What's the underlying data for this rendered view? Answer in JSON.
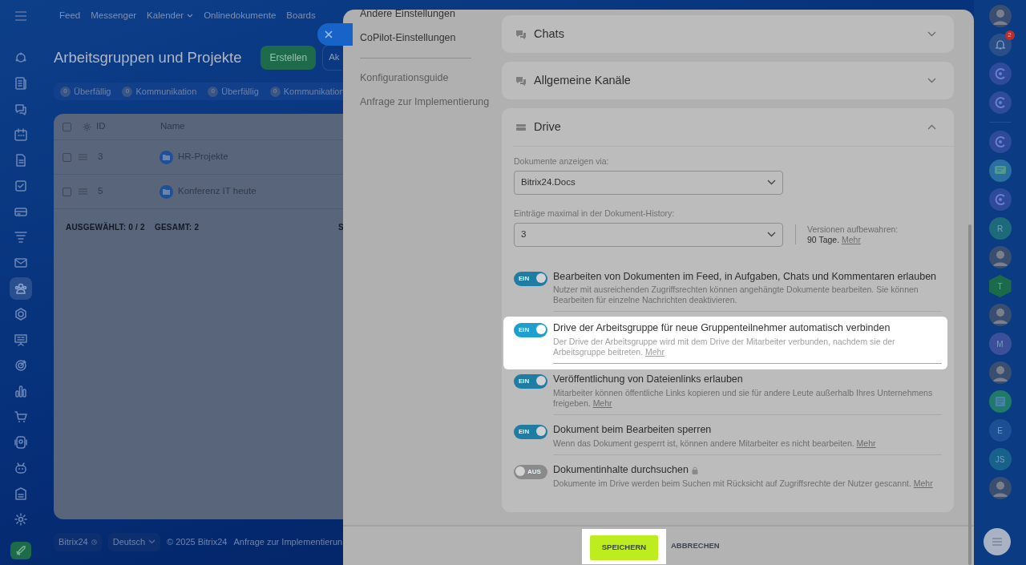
{
  "left_rail": [
    {
      "selected": false
    },
    {
      "selected": false
    },
    {
      "selected": false
    },
    {
      "selected": false
    },
    {
      "selected": false
    },
    {
      "selected": false
    },
    {
      "selected": false
    },
    {
      "selected": false
    },
    {
      "selected": false
    },
    {
      "selected": true
    },
    {
      "selected": false
    },
    {
      "selected": false
    },
    {
      "selected": false
    },
    {
      "selected": false
    },
    {
      "selected": false
    },
    {
      "selected": false
    },
    {
      "selected": false
    },
    {
      "selected": false
    },
    {
      "selected": false
    }
  ],
  "top_nav": [
    {
      "label": "Feed",
      "kind": "link"
    },
    {
      "label": "Messenger",
      "kind": "link"
    },
    {
      "label": "Kalender",
      "kind": "dropdown"
    },
    {
      "label": "Onlinedokumente",
      "kind": "link"
    },
    {
      "label": "Boards",
      "kind": "link"
    }
  ],
  "page": {
    "title": "Arbeitsgruppen und Projekte",
    "buttons": [
      {
        "label": "Erstellen",
        "kind": "primary"
      },
      {
        "label": "Ak",
        "kind": "secondary"
      }
    ],
    "counters": [
      {
        "count": "0",
        "label": "Überfällig"
      },
      {
        "count": "0",
        "label": "Kommunikation"
      },
      {
        "count": "0",
        "label": "Überfällig"
      },
      {
        "count": "0",
        "label": "Kommunikation"
      }
    ],
    "grid": {
      "columns": [
        "ID",
        "Name"
      ],
      "select_all_checked": false,
      "rows": [
        {
          "id": "3",
          "name": "HR-Projekte",
          "selected": false
        },
        {
          "id": "5",
          "name": "Konferenz IT heute",
          "selected": false
        }
      ],
      "footer": [
        {
          "label": "AUSGEWÄHLT:",
          "value": "0 / 2"
        },
        {
          "label": "GESAMT:",
          "value": "2"
        },
        {
          "label": "S"
        }
      ]
    }
  },
  "footer": {
    "brand": "Bitrix24",
    "language": "Deutsch",
    "copyright": "© 2025 Bitrix24",
    "link": "Anfrage zur Implementierun"
  },
  "right_rail": [
    {
      "kind": "avatar"
    },
    {
      "kind": "bell",
      "badge": "2"
    },
    {
      "kind": "app"
    },
    {
      "kind": "app"
    },
    {
      "kind": "divider"
    },
    {
      "kind": "app"
    },
    {
      "kind": "chat"
    },
    {
      "kind": "app"
    },
    {
      "kind": "letter",
      "text": "R",
      "color": "#1d6b7a"
    },
    {
      "kind": "avatar"
    },
    {
      "kind": "hexagon",
      "text": "T",
      "color": "#1b6b4a"
    },
    {
      "kind": "avatar"
    },
    {
      "kind": "letter",
      "text": "M",
      "color": "#3b4f9a"
    },
    {
      "kind": "avatar"
    },
    {
      "kind": "news"
    },
    {
      "kind": "letter",
      "text": "E",
      "color": "#1c4f93"
    },
    {
      "kind": "letter",
      "text": "JS",
      "color": "#17628a"
    },
    {
      "kind": "avatar"
    }
  ],
  "panel": {
    "menu": [
      {
        "label": "Andere Einstellungen",
        "kind": "item"
      },
      {
        "label": "CoPilot-Einstellungen",
        "kind": "item"
      },
      {
        "kind": "divider"
      },
      {
        "label": "Konfigurationsguide",
        "kind": "muted"
      },
      {
        "label": "Anfrage zur Implementierung",
        "kind": "muted"
      }
    ],
    "sections": [
      {
        "title": "Chats",
        "expanded": false
      },
      {
        "title": "Allgemeine Kanäle",
        "expanded": false
      },
      {
        "title": "Drive",
        "expanded": true,
        "selects": [
          {
            "label": "Dokumente anzeigen via:",
            "value": "Bitrix24.Docs"
          },
          {
            "label": "Einträge maximal in der Dokument-History:",
            "value": "3",
            "note": "Versionen aufbewahren:",
            "note_value": "90 Tage.",
            "note_link": "Mehr"
          }
        ],
        "toggles": [
          {
            "title": "Bearbeiten von Dokumenten im Feed, in Aufgaben, Chats und Kommentaren erlauben",
            "description": "Nutzer mit ausreichenden Zugriffsrechten können angehängte Dokumente bearbeiten. Sie können Bearbeiten für einzelne Nachrichten deaktivieren.",
            "on": true,
            "switch_label": "EIN",
            "highlighted": false,
            "locked": false
          },
          {
            "title": "Drive der Arbeitsgruppe für neue Gruppenteilnehmer automatisch verbinden",
            "description": "Der Drive der Arbeitsgruppe wird mit dem Drive der Mitarbeiter verbunden, nachdem sie der Arbeitsgruppe beitreten.",
            "link": "Mehr",
            "on": true,
            "switch_label": "EIN",
            "highlighted": true,
            "locked": false
          },
          {
            "title": "Veröffentlichung von Dateienlinks erlauben",
            "description": "Mitarbeiter können öffentliche Links kopieren und sie für andere Leute außerhalb Ihres Unternehmens freigeben.",
            "link": "Mehr",
            "on": true,
            "switch_label": "EIN",
            "highlighted": false,
            "locked": false
          },
          {
            "title": "Dokument beim Bearbeiten sperren",
            "description": "Wenn das Dokument gesperrt ist, können andere Mitarbeiter es nicht bearbeiten.",
            "link": "Mehr",
            "on": true,
            "switch_label": "EIN",
            "highlighted": false,
            "locked": false
          },
          {
            "title": "Dokumentinhalte durchsuchen",
            "description": "Dokumente im Drive werden beim Suchen mit Rücksicht auf Zugriffsrechte der Nutzer gescannt.",
            "link": "Mehr",
            "on": false,
            "switch_label": "AUS",
            "highlighted": false,
            "locked": true
          }
        ]
      }
    ],
    "footer_buttons": [
      {
        "label": "SPEICHERN",
        "kind": "primary",
        "highlighted": true
      },
      {
        "label": "ABBRECHEN",
        "kind": "link",
        "highlighted": false
      }
    ]
  }
}
